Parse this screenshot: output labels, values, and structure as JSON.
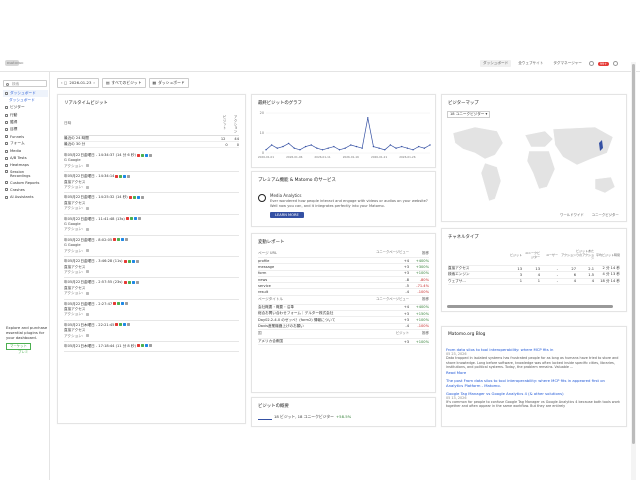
{
  "topbar": {
    "logo_text": "matomo",
    "nav": [
      "ダッシュボード",
      "全ウェブサイト",
      "タグマネージャー"
    ],
    "badge": "99+"
  },
  "sidebar": {
    "search_placeholder": "検索",
    "items": [
      {
        "label": "ダッシュボード",
        "selected": true
      },
      {
        "label": "ダッシュボード",
        "sub": true
      },
      {
        "label": "ビジター"
      },
      {
        "label": "行動"
      },
      {
        "label": "獲得"
      },
      {
        "label": "目標"
      },
      {
        "label": "Funnels"
      },
      {
        "label": "フォーム"
      },
      {
        "label": "Media"
      },
      {
        "label": "A/B Tests"
      },
      {
        "label": "Heatmaps"
      },
      {
        "label": "Session Recordings",
        "tall": true
      },
      {
        "label": "Custom Reports"
      },
      {
        "label": "Crashes"
      },
      {
        "label": "AI Assistants"
      }
    ],
    "promo_text": "Explore and purchase essential plugins for your dashboard.",
    "promo_button": "マーケット",
    "premium_label": "プレミ"
  },
  "toolbar": {
    "date": "2026-01-23",
    "all_visits": "すべてのビジット",
    "dashboard": "ダッシュボード"
  },
  "realtime": {
    "title": "リアルタイムビジット",
    "head": {
      "col0": "日時",
      "col1": "ビジット",
      "col2": "アクション"
    },
    "rows": [
      {
        "label": "最近の 24 時間",
        "visits": "12",
        "actions": "44"
      },
      {
        "label": "最近の 30 分",
        "visits": "0",
        "actions": "0"
      }
    ],
    "visits": [
      {
        "time": "年05月22日金曜日 - 14:34:37 (14 分 6 秒)",
        "detail": "G Google",
        "actions": "アクション:"
      },
      {
        "time": "年05月22日金曜日 - 14:34:14",
        "detail": "直接アクセス",
        "actions": "アクション:"
      },
      {
        "time": "年05月22日金曜日 - 14:25:32 (14 秒)",
        "detail": "直接アクセス",
        "actions": "アクション:"
      },
      {
        "time": "年05月22日金曜日 - 11:41:48 (13s)",
        "detail": "G Google",
        "actions": "アクション:"
      },
      {
        "time": "年05月22日金曜日 - 8:02:05",
        "detail": "G Google",
        "actions": "アクション:"
      },
      {
        "time": "年05月22日金曜日 - 3:46:28 (11s)",
        "detail": "直接アクセス",
        "actions": "アクション:"
      },
      {
        "time": "年05月22日金曜日 - 2:57:55 (23s)",
        "detail": "直接アクセス",
        "actions": "アクション:"
      },
      {
        "time": "年05月22日金曜日 - 2:27:47",
        "detail": "直接アクセス",
        "actions": "アクション:"
      },
      {
        "time": "年05月21日木曜日 - 22:21:45",
        "detail": "直接アクセス",
        "actions": "アクション:"
      },
      {
        "time": "年05月21日木曜日 - 17:18:44 (11 分 8 秒)",
        "detail": "",
        "actions": ""
      }
    ]
  },
  "graph": {
    "title": "最終ビジットのグラフ",
    "y_ticks": [
      "20",
      "10",
      "0"
    ]
  },
  "chart_data": {
    "type": "line",
    "title": "",
    "x": [
      "2026-01-01",
      "2026-01-02",
      "2026-01-03",
      "2026-01-04",
      "2026-01-05",
      "2026-01-06",
      "2026-01-07",
      "2026-01-08",
      "2026-01-09",
      "2026-01-10",
      "2026-01-11",
      "2026-01-12",
      "2026-01-13",
      "2026-01-14",
      "2026-01-15",
      "2026-01-16",
      "2026-01-17",
      "2026-01-18",
      "2026-01-19",
      "2026-01-20",
      "2026-01-21",
      "2026-01-22",
      "2026-01-23",
      "2026-01-24",
      "2026-01-25",
      "2026-01-26",
      "2026-01-27",
      "2026-01-28",
      "2026-01-29",
      "2026-01-30"
    ],
    "series": [
      {
        "values": [
          2,
          5,
          3,
          4,
          6,
          3,
          2,
          4,
          5,
          3,
          2,
          3,
          4,
          2,
          3,
          5,
          4,
          3,
          22,
          4,
          3,
          2,
          5,
          3,
          4,
          3,
          2,
          4,
          3,
          5
        ]
      }
    ],
    "ylim": [
      0,
      25
    ],
    "grid": true,
    "color": "#3450a3"
  },
  "premium": {
    "title": "プレミアム機能 & Matomo のサービス",
    "product": "Media Analytics",
    "desc": "Ever wondered how people interact and engage with videos or audios on your website? Well now you can, and it integrates perfectly into your Matomo.",
    "button": "LEARN MORE"
  },
  "changes": {
    "title": "変動レポート",
    "head1": {
      "c1": "ページ URL",
      "c2": "ユニークページビュー",
      "c3": "推移"
    },
    "rows1": [
      {
        "c1": "profile",
        "c2": "+4",
        "c3": "+400%",
        "pos": true
      },
      {
        "c1": "message",
        "c2": "+3",
        "c3": "+300%",
        "pos": true
      },
      {
        "c1": "form",
        "c2": "+3",
        "c3": "+100%",
        "pos": true
      },
      {
        "c1": "news",
        "c2": "-8",
        "c3": "-80%",
        "pos": false
      },
      {
        "c1": "service",
        "c2": "-5",
        "c3": "-71.4%",
        "pos": false
      },
      {
        "c1": "result",
        "c2": "-4",
        "c3": "-100%",
        "pos": false
      }
    ],
    "head2": {
      "c1": "ページタイトル",
      "c2": "ユニークページビュー",
      "c3": "推移"
    },
    "rows2": [
      {
        "c1": "会社概要・概要・沿革",
        "c2": "+4",
        "c3": "+400%",
        "pos": true
      },
      {
        "c1": "総合お問い合わせフォーム｜デルター株式会社",
        "c2": "+3",
        "c3": "+150%",
        "pos": true
      },
      {
        "c1": "Day02.2-4.0 のゼッペ！(form2) 情報について",
        "c2": "+3",
        "c3": "+100%",
        "pos": true
      },
      {
        "c1": "Davis産業機器上げのお願い",
        "c2": "-4",
        "c3": "-100%",
        "pos": false
      }
    ],
    "head3": {
      "c1": "国",
      "c2": "ビジット",
      "c3": "推移"
    },
    "rows3": [
      {
        "c1": "アメリカ合衆国",
        "c2": "+3",
        "c3": "+100%",
        "pos": true
      }
    ]
  },
  "overview": {
    "title": "ビジットの概要",
    "line": "18 ビジット, 18 ユニークビジター",
    "change": "+58.5%"
  },
  "map": {
    "title": "ビジターマップ",
    "metric": "18 ユニークビジター",
    "footer_left": "ワールドワイド",
    "footer_right": "ユニークビジター"
  },
  "channels": {
    "title": "チャネルタイプ",
    "head": [
      "",
      "ビジット",
      "ユニークビジター",
      "ユーザー",
      "アクション",
      "ビジットあたりのアクション",
      "平均ビジット時間"
    ],
    "rows": [
      [
        "直接アクセス",
        "13",
        "13",
        "-",
        "27",
        "2.1",
        "2 分 14 秒"
      ],
      [
        "検索エンジン",
        "3",
        "4",
        "-",
        "6",
        "1.5",
        "4 分 13 秒"
      ],
      [
        "ウェブサ...",
        "1",
        "1",
        "-",
        "4",
        "4",
        "18 分 14 秒"
      ]
    ]
  },
  "blog": {
    "title": "Matomo.org Blog",
    "posts": [
      {
        "title": "From data silos to tool interoperability: where MCP fits in",
        "date": "05 23, 2026",
        "text": "Data trapped in isolated systems has frustrated people for as long as humans have tried to store and share knowledge. Long before software, knowledge was often locked inside specific cities, libraries, institutions, and political systems. Today, the problem remains. Valuable ...",
        "more": "Read More"
      },
      {
        "title": "The post From data silos to tool interoperability: where MCP fits in appeared first on Analytics Platform - Matomo.",
        "date": "",
        "text": "",
        "more": ""
      },
      {
        "title": "Google Tag Manager vs Google Analytics 4 (& other solutions)",
        "date": "05 13, 2026",
        "text": "It's common for people to confuse Google Tag Manager vs Google Analytics 4 because both tools work together and often appear in the same workflow. But they are entirely",
        "more": ""
      }
    ]
  }
}
